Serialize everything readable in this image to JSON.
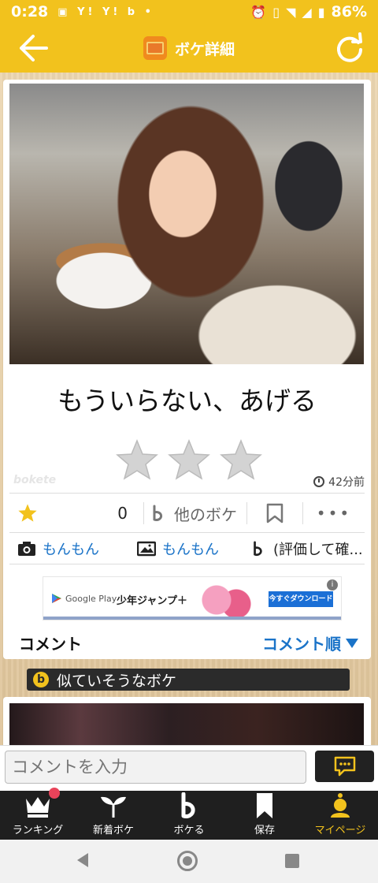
{
  "status": {
    "time": "0:28",
    "icons": "▣ Y! Y! b •",
    "battery": "86%"
  },
  "appbar": {
    "title": "ボケ詳細"
  },
  "post": {
    "caption": "もういらない、あげる",
    "brand": "bokete",
    "time_ago": "42分前",
    "star_count": "0",
    "other_boke_label": "他のボケ",
    "more": "•••",
    "photo_author": "もんもん",
    "image_author": "もんもん",
    "boke_author": "(評価して確..."
  },
  "ad": {
    "store": "Google Play",
    "title": "少年ジャンプ＋",
    "cta": "今すぐダウンロード",
    "info": "i"
  },
  "comments": {
    "label": "コメント",
    "sort_label": "コメント順"
  },
  "similar": {
    "label": "似ていそうなボケ"
  },
  "comment_input": {
    "placeholder": "コメントを入力"
  },
  "tabs": [
    {
      "label": "ランキング"
    },
    {
      "label": "新着ボケ"
    },
    {
      "label": "ボケる"
    },
    {
      "label": "保存"
    },
    {
      "label": "マイページ"
    }
  ],
  "colors": {
    "accent": "#f2c21d",
    "link": "#1a73c8",
    "dark": "#1f1f1f"
  }
}
